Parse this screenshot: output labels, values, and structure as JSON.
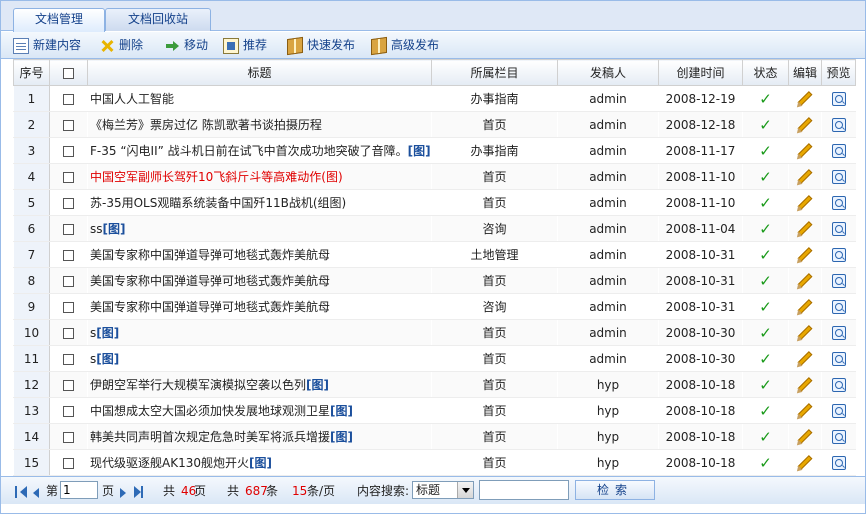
{
  "tabs": [
    {
      "label": "文档管理"
    },
    {
      "label": "文档回收站"
    }
  ],
  "toolbar": {
    "new": "新建内容",
    "delete": "删除",
    "move": "移动",
    "recommend": "推荐",
    "quick_publish": "快速发布",
    "advanced_publish": "高级发布"
  },
  "columns": {
    "index": "序号",
    "title": "标题",
    "category": "所属栏目",
    "author": "发稿人",
    "created": "创建时间",
    "status": "状态",
    "edit": "编辑",
    "preview": "预览"
  },
  "rows": [
    {
      "n": "1",
      "title": "中国人人工智能",
      "tag": "",
      "cat": "办事指南",
      "author": "admin",
      "date": "2008-12-19",
      "red": false
    },
    {
      "n": "2",
      "title": "《梅兰芳》票房过亿 陈凯歌著书谈拍摄历程",
      "tag": "",
      "cat": "首页",
      "author": "admin",
      "date": "2008-12-18",
      "red": false
    },
    {
      "n": "3",
      "title": "F-35 “闪电II” 战斗机日前在试飞中首次成功地突破了音障。",
      "tag": "[图]",
      "cat": "办事指南",
      "author": "admin",
      "date": "2008-11-17",
      "red": false
    },
    {
      "n": "4",
      "title": "中国空军副师长驾歼10飞斜斤斗等高难动作(图)",
      "tag": "",
      "cat": "首页",
      "author": "admin",
      "date": "2008-11-10",
      "red": true
    },
    {
      "n": "5",
      "title": "苏-35用OLS观瞄系统装备中国歼11B战机(组图)",
      "tag": "",
      "cat": "首页",
      "author": "admin",
      "date": "2008-11-10",
      "red": false
    },
    {
      "n": "6",
      "title": "ss",
      "tag": "[图]",
      "cat": "咨询",
      "author": "admin",
      "date": "2008-11-04",
      "red": false
    },
    {
      "n": "7",
      "title": "美国专家称中国弹道导弹可地毯式轰炸美航母",
      "tag": "",
      "cat": "土地管理",
      "author": "admin",
      "date": "2008-10-31",
      "red": false
    },
    {
      "n": "8",
      "title": "美国专家称中国弹道导弹可地毯式轰炸美航母",
      "tag": "",
      "cat": "首页",
      "author": "admin",
      "date": "2008-10-31",
      "red": false
    },
    {
      "n": "9",
      "title": "美国专家称中国弹道导弹可地毯式轰炸美航母",
      "tag": "",
      "cat": "咨询",
      "author": "admin",
      "date": "2008-10-31",
      "red": false
    },
    {
      "n": "10",
      "title": "s",
      "tag": "[图]",
      "cat": "首页",
      "author": "admin",
      "date": "2008-10-30",
      "red": false
    },
    {
      "n": "11",
      "title": "s",
      "tag": "[图]",
      "cat": "首页",
      "author": "admin",
      "date": "2008-10-30",
      "red": false
    },
    {
      "n": "12",
      "title": "伊朗空军举行大规模军演模拟空袭以色列",
      "tag": "[图]",
      "cat": "首页",
      "author": "hyp",
      "date": "2008-10-18",
      "red": false
    },
    {
      "n": "13",
      "title": "中国想成太空大国必须加快发展地球观测卫星",
      "tag": "[图]",
      "cat": "首页",
      "author": "hyp",
      "date": "2008-10-18",
      "red": false
    },
    {
      "n": "14",
      "title": "韩美共同声明首次规定危急时美军将派兵增援",
      "tag": "[图]",
      "cat": "首页",
      "author": "hyp",
      "date": "2008-10-18",
      "red": false
    },
    {
      "n": "15",
      "title": "现代级驱逐舰AK130舰炮开火",
      "tag": "[图]",
      "cat": "首页",
      "author": "hyp",
      "date": "2008-10-18",
      "red": false
    }
  ],
  "pager": {
    "page_prefix": "第",
    "page_value": "1",
    "page_suffix": "页",
    "total_prefix": "共",
    "total_pages": "46",
    "total_pages_suffix": "页",
    "count_prefix": "共",
    "total_count": "687",
    "count_suffix": "条",
    "per_page": "15",
    "per_page_suffix": "条/页",
    "search_label": "内容搜索:",
    "search_field": "标题",
    "search_button": "检索"
  },
  "colors": {
    "accent": "#15428b",
    "highlight_red": "#e00000",
    "status_ok": "#1a9a1a"
  }
}
